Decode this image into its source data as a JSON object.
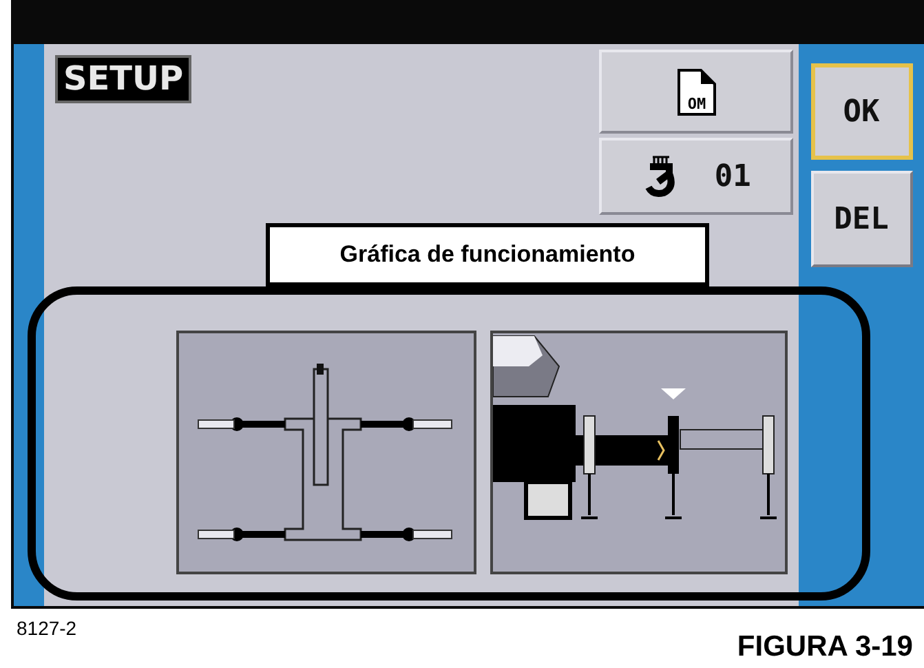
{
  "screen": {
    "title": "SETUP",
    "top_buttons": [
      {
        "kind": "file",
        "icon_label": "OM"
      },
      {
        "kind": "hook",
        "value": "01"
      }
    ],
    "side_buttons": [
      {
        "label": "OK",
        "selected": true
      },
      {
        "label": "DEL",
        "selected": false
      }
    ]
  },
  "callout": "Gráfica de funcionamiento",
  "caption": {
    "code": "8127-2",
    "figure": "FIGURA 3-19"
  }
}
